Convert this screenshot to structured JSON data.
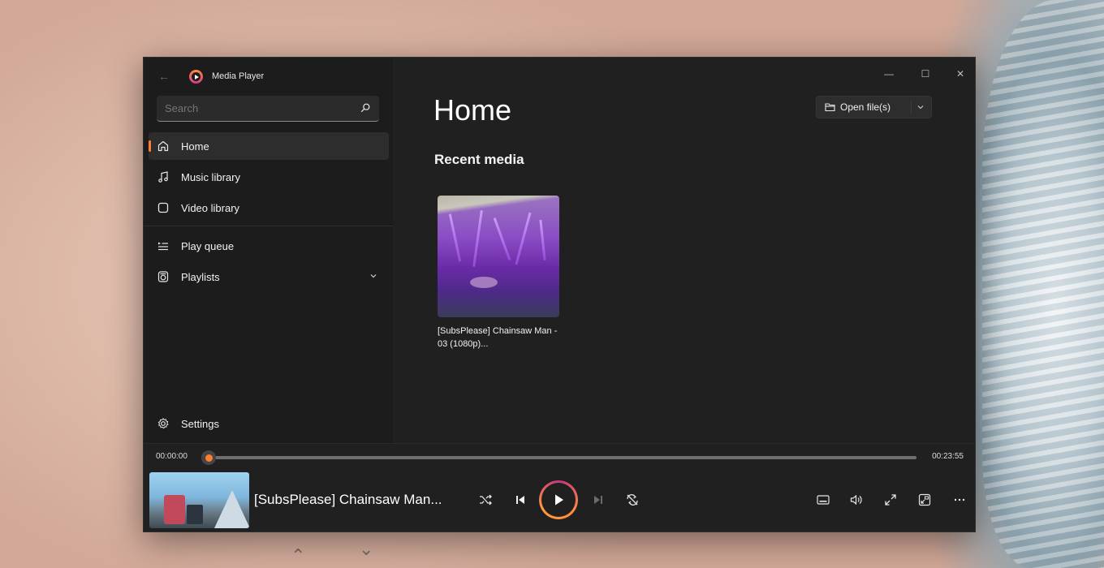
{
  "app": {
    "title": "Media Player"
  },
  "search": {
    "placeholder": "Search"
  },
  "nav": {
    "items": [
      {
        "label": "Home",
        "icon": "home-icon",
        "active": true
      },
      {
        "label": "Music library",
        "icon": "music-note-icon"
      },
      {
        "label": "Video library",
        "icon": "video-icon"
      },
      {
        "label": "Play queue",
        "icon": "queue-icon"
      },
      {
        "label": "Playlists",
        "icon": "playlist-icon"
      }
    ],
    "settings_label": "Settings"
  },
  "main": {
    "title": "Home",
    "open_button_label": "Open file(s)",
    "section_title": "Recent media",
    "recent": [
      {
        "title": "[SubsPlease] Chainsaw Man - 03 (1080p)..."
      }
    ]
  },
  "player": {
    "current_time": "00:00:00",
    "total_time": "00:23:55",
    "progress": 0,
    "now_playing_title": "[SubsPlease] Chainsaw Man..."
  },
  "colors": {
    "accent": "#ff7e2e",
    "accent_secondary": "#c8367b",
    "window_bg": "#202020",
    "sidebar_bg": "#1c1c1c"
  }
}
